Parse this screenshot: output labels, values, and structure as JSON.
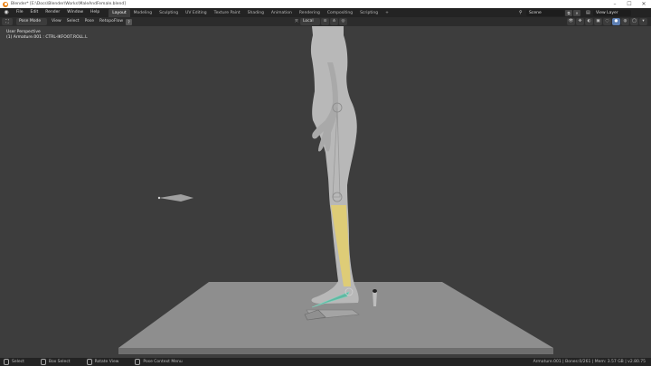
{
  "window": {
    "title": "Blender* [E:\\Docs\\Blender\\Works\\MaleAndFemale.blend]",
    "controls": [
      "–",
      "☐",
      "✕"
    ]
  },
  "topbar": {
    "menu": [
      "File",
      "Edit",
      "Render",
      "Window",
      "Help"
    ],
    "workspaces": [
      "Layout",
      "Modeling",
      "Sculpting",
      "UV Editing",
      "Texture Paint",
      "Shading",
      "Animation",
      "Rendering",
      "Compositing",
      "Scripting",
      "+"
    ],
    "active_workspace": "Layout",
    "scene": "Scene",
    "view_layer": "View Layer"
  },
  "viewport_header": {
    "mode": "Pose Mode",
    "menu": [
      "View",
      "Select",
      "Pose"
    ],
    "retopoflow": "RetopoFlow",
    "help": "?",
    "orientation": "Local"
  },
  "viewport": {
    "view_label": "User Perspective",
    "object_label": "(1) Armature.001 : CTRL-IKFOOT.ROLL.L"
  },
  "statusbar": {
    "hints": [
      "Select",
      "Box Select",
      "Rotate View",
      "Pose Context Menu"
    ],
    "stats": "Armature.001 | Bones:0/261 | Mem: 3.57 GB | v2.80.75"
  },
  "colors": {
    "viewport_bg": "#3d3d3d",
    "selected_bone": "#e4cf6b",
    "active_bone": "#5fb8a2",
    "floor": "#909090"
  }
}
